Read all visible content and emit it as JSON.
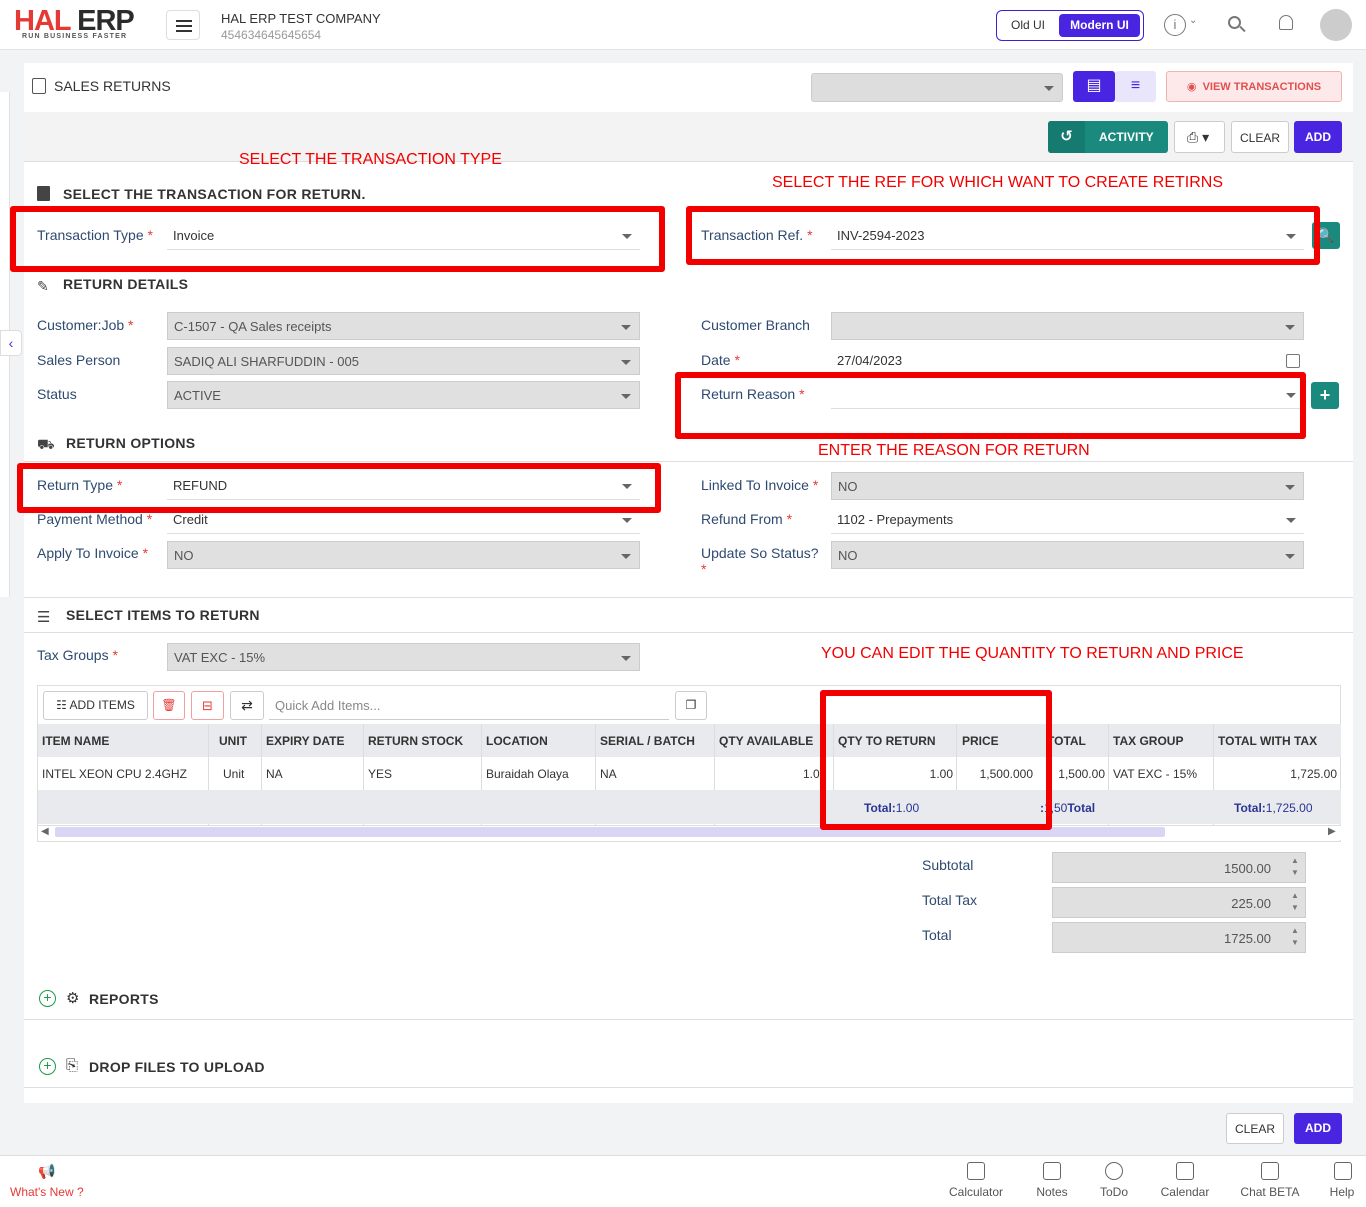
{
  "header": {
    "logo_main": "HAL",
    "logo_erp": "ERP",
    "logo_tagline": "RUN BUSINESS FASTER",
    "company_name": "HAL ERP TEST COMPANY",
    "company_id": "454634645645654",
    "ui_old": "Old UI",
    "ui_modern": "Modern UI",
    "icons": [
      "info-icon",
      "search-icon",
      "bell-icon",
      "avatar"
    ]
  },
  "page": {
    "title": "SALES RETURNS",
    "view_transactions": "VIEW TRANSACTIONS",
    "activity": "ACTIVITY",
    "clear": "CLEAR",
    "add": "ADD"
  },
  "annotations": {
    "transaction_type": "SELECT THE TRANSACTION TYPE",
    "ref": "SELECT THE REF FOR WHICH WANT TO CREATE RETIRNS",
    "reason": "ENTER THE REASON FOR RETURN",
    "qty_price": "YOU CAN EDIT THE QUANTITY TO RETURN AND PRICE"
  },
  "transaction": {
    "section_title": "SELECT THE TRANSACTION FOR RETURN.",
    "type_label": "Transaction Type",
    "type_value": "Invoice",
    "ref_label": "Transaction Ref.",
    "ref_value": "INV-2594-2023"
  },
  "return_details": {
    "section_title": "RETURN DETAILS",
    "customer_label": "Customer:Job",
    "customer_value": "C-1507 - QA Sales receipts",
    "sales_person_label": "Sales Person",
    "sales_person_value": "SADIQ ALI  SHARFUDDIN - 005",
    "status_label": "Status",
    "status_value": "ACTIVE",
    "branch_label": "Customer Branch",
    "branch_value": "",
    "date_label": "Date",
    "date_value": "27/04/2023",
    "reason_label": "Return Reason",
    "reason_value": ""
  },
  "return_options": {
    "section_title": "RETURN OPTIONS",
    "return_type_label": "Return Type",
    "return_type_value": "REFUND",
    "payment_method_label": "Payment Method",
    "payment_method_value": "Credit",
    "apply_invoice_label": "Apply To Invoice",
    "apply_invoice_value": "NO",
    "linked_invoice_label": "Linked To Invoice",
    "linked_invoice_value": "NO",
    "refund_from_label": "Refund From",
    "refund_from_value": "1102 - Prepayments",
    "update_so_label": "Update So Status?",
    "update_so_value": "NO"
  },
  "items": {
    "section_title": "SELECT ITEMS TO RETURN",
    "tax_groups_label": "Tax Groups",
    "tax_groups_value": "VAT EXC - 15%",
    "add_items": "ADD ITEMS",
    "quick_add_placeholder": "Quick Add Items...",
    "columns": [
      "ITEM NAME",
      "UNIT",
      "EXPIRY DATE",
      "RETURN STOCK",
      "LOCATION",
      "SERIAL / BATCH",
      "QTY AVAILABLE",
      "QTY TO RETURN",
      "PRICE",
      "TOTAL",
      "TAX GROUP",
      "TOTAL WITH TAX"
    ],
    "rows": [
      {
        "item_name": "INTEL XEON CPU 2.4GHZ",
        "unit": "Unit",
        "expiry": "NA",
        "return_stock": "YES",
        "location": "Buraidah Olaya",
        "serial": "NA",
        "qty_available": "1.0",
        "qty_return": "1.00",
        "price": "1,500.000",
        "total": "1,500.00",
        "tax_group": "VAT EXC - 15%",
        "total_with_tax": "1,725.00"
      }
    ],
    "footer": {
      "total_label": "Total:",
      "qty_total": "1.00",
      "total_total": "1,50",
      "total_with_tax": "1,725.00"
    }
  },
  "summary": {
    "subtotal_label": "Subtotal",
    "subtotal_value": "1500.00",
    "tax_label": "Total Tax",
    "tax_value": "225.00",
    "total_label": "Total",
    "total_value": "1725.00"
  },
  "sections": {
    "reports": "REPORTS",
    "drop_files": "DROP FILES TO UPLOAD"
  },
  "footer": {
    "whats_new": "What's New ?",
    "items": [
      "Calculator",
      "Notes",
      "ToDo",
      "Calendar",
      "Chat BETA",
      "Help"
    ]
  },
  "colors": {
    "accent": "#4a25e1",
    "teal": "#1b8a7e",
    "annotation_red": "#f20000"
  }
}
